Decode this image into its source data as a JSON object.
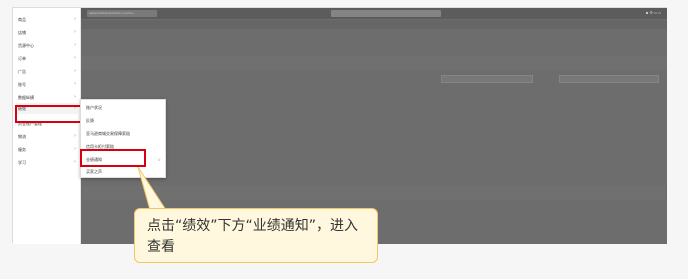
{
  "menu": {
    "items": [
      {
        "label": "商品"
      },
      {
        "label": "店铺"
      },
      {
        "label": "货源中心"
      },
      {
        "label": "订单"
      },
      {
        "label": "广告"
      },
      {
        "label": "账号"
      },
      {
        "label": "数据纵横"
      },
      {
        "label": "绩效"
      },
      {
        "label": "资金账户管理"
      },
      {
        "label": "物流"
      },
      {
        "label": "服务"
      },
      {
        "label": "学习"
      }
    ]
  },
  "submenu": {
    "items": [
      {
        "label": "账户状况"
      },
      {
        "label": "反馈"
      },
      {
        "label": "亚马逊商城交易保障索赔"
      },
      {
        "label": "信用卡拒付索赔"
      },
      {
        "label": "业绩通知"
      },
      {
        "label": "买家之声"
      }
    ],
    "badge": "☆"
  },
  "topbar": {
    "url_text": "sellercentral.amazon.com/ho..."
  },
  "callout": {
    "text": "点击“绩效”下方“业绩通知”，进入查看"
  }
}
